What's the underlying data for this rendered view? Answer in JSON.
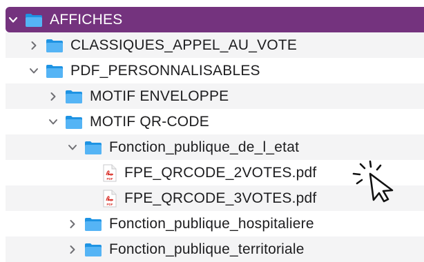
{
  "colors": {
    "selected_bg": "#74337e",
    "folder_blue": "#1f9bea",
    "pdf_red": "#d9322b",
    "alt_row": "#f4f4f5"
  },
  "tree": [
    {
      "label": "AFFICHES",
      "type": "folder",
      "expanded": true,
      "selected": true,
      "depth": 0
    },
    {
      "label": "CLASSIQUES_APPEL_AU_VOTE",
      "type": "folder",
      "expanded": false,
      "selected": false,
      "depth": 1
    },
    {
      "label": "PDF_PERSONNALISABLES",
      "type": "folder",
      "expanded": true,
      "selected": false,
      "depth": 1
    },
    {
      "label": "MOTIF ENVELOPPE",
      "type": "folder",
      "expanded": false,
      "selected": false,
      "depth": 2
    },
    {
      "label": "MOTIF QR-CODE",
      "type": "folder",
      "expanded": true,
      "selected": false,
      "depth": 2
    },
    {
      "label": "Fonction_publique_de_l_etat",
      "type": "folder",
      "expanded": true,
      "selected": false,
      "depth": 3
    },
    {
      "label": "FPE_QRCODE_2VOTES.pdf",
      "type": "pdf",
      "icon_text": "PDF",
      "depth": 4
    },
    {
      "label": "FPE_QRCODE_3VOTES.pdf",
      "type": "pdf",
      "icon_text": "PDF",
      "depth": 4
    },
    {
      "label": "Fonction_publique_hospitaliere",
      "type": "folder",
      "expanded": false,
      "selected": false,
      "depth": 3
    },
    {
      "label": "Fonction_publique_territoriale",
      "type": "folder",
      "expanded": false,
      "selected": false,
      "depth": 3
    }
  ],
  "icons": {
    "folder": "folder-icon",
    "pdf": "pdf-file-icon",
    "chevron_right": "chevron-right-icon",
    "chevron_down": "chevron-down-icon",
    "cursor": "click-cursor-icon"
  }
}
